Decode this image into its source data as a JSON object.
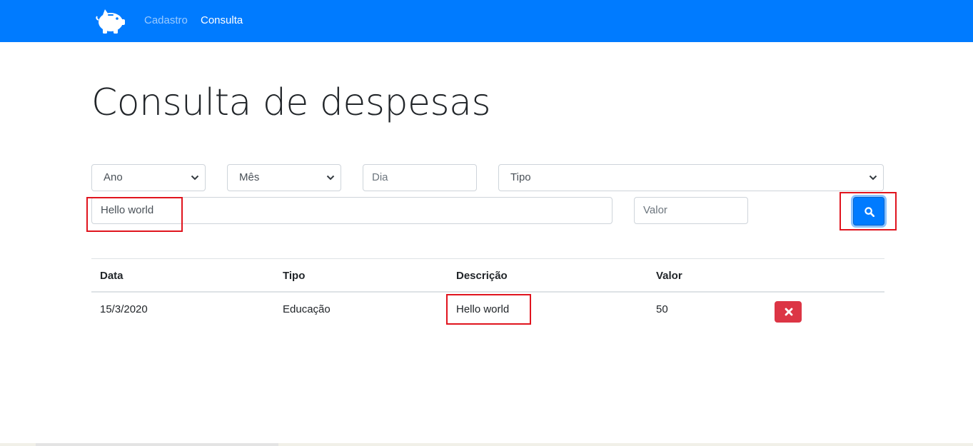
{
  "navbar": {
    "brand_icon": "piggy-bank-icon",
    "links": [
      {
        "label": "Cadastro",
        "active": false
      },
      {
        "label": "Consulta",
        "active": true
      }
    ],
    "background_color": "#007bff"
  },
  "page": {
    "title": "Consulta de despesas"
  },
  "filters": {
    "ano": {
      "selected": "Ano"
    },
    "mes": {
      "selected": "Mês"
    },
    "dia": {
      "placeholder": "Dia",
      "value": ""
    },
    "tipo": {
      "selected": "Tipo"
    },
    "descricao": {
      "value": "Hello world"
    },
    "valor": {
      "placeholder": "Valor",
      "value": ""
    },
    "search_button_icon": "search-icon"
  },
  "table": {
    "headers": [
      "Data",
      "Tipo",
      "Descrição",
      "Valor"
    ],
    "rows": [
      {
        "data": "15/3/2020",
        "tipo": "Educação",
        "descricao": "Hello world",
        "valor": "50",
        "action_icon": "close-icon"
      }
    ]
  },
  "colors": {
    "primary": "#007bff",
    "danger": "#dc3545",
    "highlight": "#e0141e"
  }
}
